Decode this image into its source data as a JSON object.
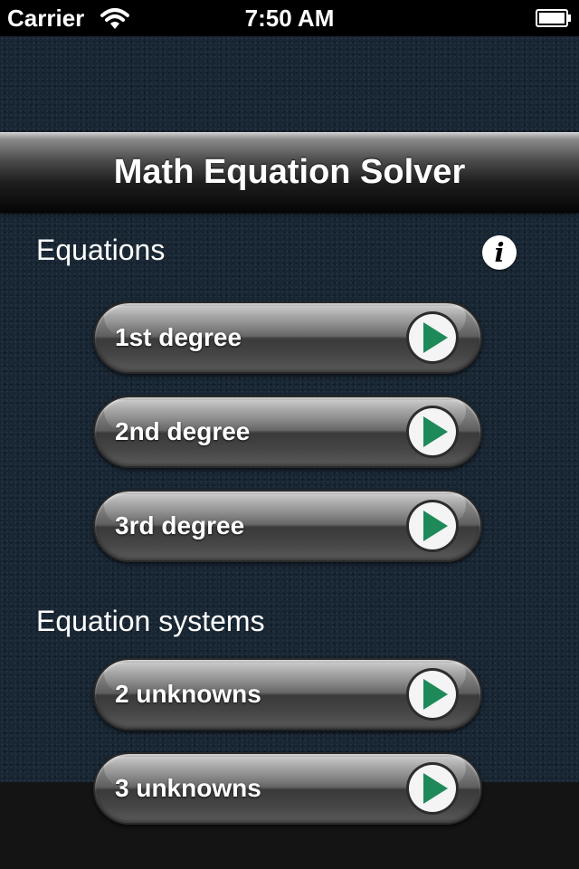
{
  "status_bar": {
    "carrier": "Carrier",
    "time": "7:50 AM"
  },
  "title_bar": {
    "title": "Math Equation Solver"
  },
  "sections": {
    "equations": {
      "header": "Equations",
      "buttons": [
        {
          "label": "1st degree"
        },
        {
          "label": "2nd degree"
        },
        {
          "label": "3rd degree"
        }
      ]
    },
    "systems": {
      "header": "Equation systems",
      "buttons": [
        {
          "label": "2 unknowns"
        },
        {
          "label": "3 unknowns"
        }
      ]
    }
  },
  "info_button": {
    "glyph": "i"
  },
  "colors": {
    "play_accent": "#1e8a5a",
    "background": "#15222f"
  },
  "icons": {
    "info": "info-icon",
    "play": "play-arrow-icon",
    "wifi": "wifi-icon",
    "battery": "battery-icon"
  }
}
